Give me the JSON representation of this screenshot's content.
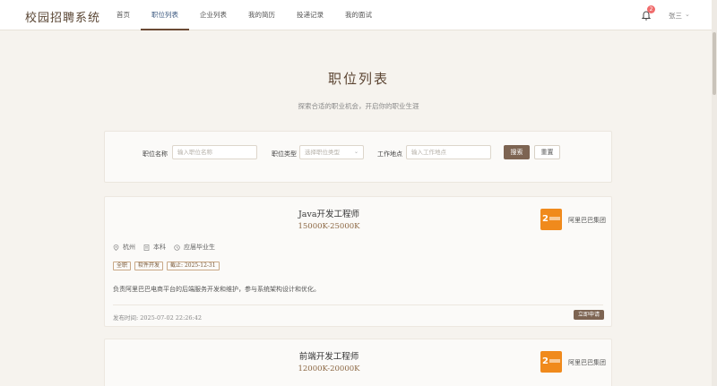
{
  "app": {
    "title": "校园招聘系统"
  },
  "nav": [
    {
      "label": "首页"
    },
    {
      "label": "职位列表"
    },
    {
      "label": "企业列表"
    },
    {
      "label": "我的简历"
    },
    {
      "label": "投递记录"
    },
    {
      "label": "我的面试"
    }
  ],
  "header": {
    "notification_count": "2",
    "user_name": "张三"
  },
  "hero": {
    "title": "职位列表",
    "subtitle": "探索合适的职业机会，开启你的职业生涯"
  },
  "search": {
    "job_name_label": "职位名称",
    "job_name_placeholder": "输入职位名称",
    "job_type_label": "职位类型",
    "job_type_placeholder": "选择职位类型",
    "location_label": "工作地点",
    "location_placeholder": "输入工作地点",
    "search_button": "搜索",
    "reset_button": "重置"
  },
  "jobs": [
    {
      "title": "Java开发工程师",
      "salary": "15000K-25000K",
      "company": "阿里巴巴集团",
      "city": "杭州",
      "education": "本科",
      "experience": "应届毕业生",
      "tags": [
        "全职",
        "软件开发",
        "截止: 2025-12-31"
      ],
      "description": "负责阿里巴巴电商平台的后端服务开发和维护，参与系统架构设计和优化。",
      "publish_time": "发布时间: 2025-07-02 22:26:42",
      "apply_label": "立即申请"
    },
    {
      "title": "前端开发工程师",
      "salary": "12000K-20000K",
      "company": "阿里巴巴集团"
    }
  ],
  "colors": {
    "accent": "#7d6452",
    "salary": "#8a6540",
    "company_logo": "#f08a1c",
    "active_nav": "#3d5a80"
  }
}
